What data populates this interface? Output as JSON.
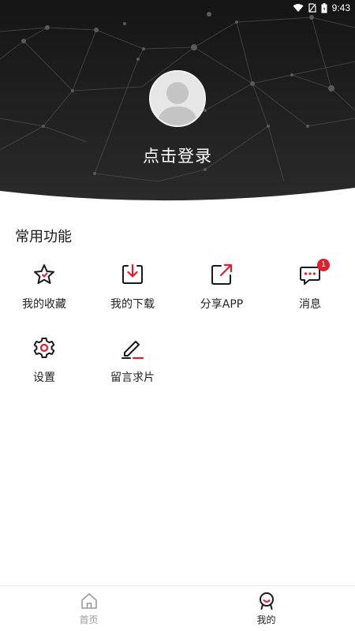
{
  "status_bar": {
    "time": "9:43"
  },
  "profile": {
    "login_label": "点击登录"
  },
  "section": {
    "title": "常用功能"
  },
  "features": [
    {
      "label": "我的收藏",
      "icon": "star-icon"
    },
    {
      "label": "我的下载",
      "icon": "download-icon"
    },
    {
      "label": "分享APP",
      "icon": "share-icon"
    },
    {
      "label": "消息",
      "icon": "message-icon",
      "badge": "1"
    },
    {
      "label": "设置",
      "icon": "gear-icon"
    },
    {
      "label": "留言求片",
      "icon": "edit-icon"
    }
  ],
  "bottom_nav": [
    {
      "label": "首页",
      "icon": "home-icon",
      "active": false
    },
    {
      "label": "我的",
      "icon": "profile-icon",
      "active": true
    }
  ],
  "colors": {
    "accent": "#e11d2e",
    "header_bg": "#1c1c1c"
  }
}
